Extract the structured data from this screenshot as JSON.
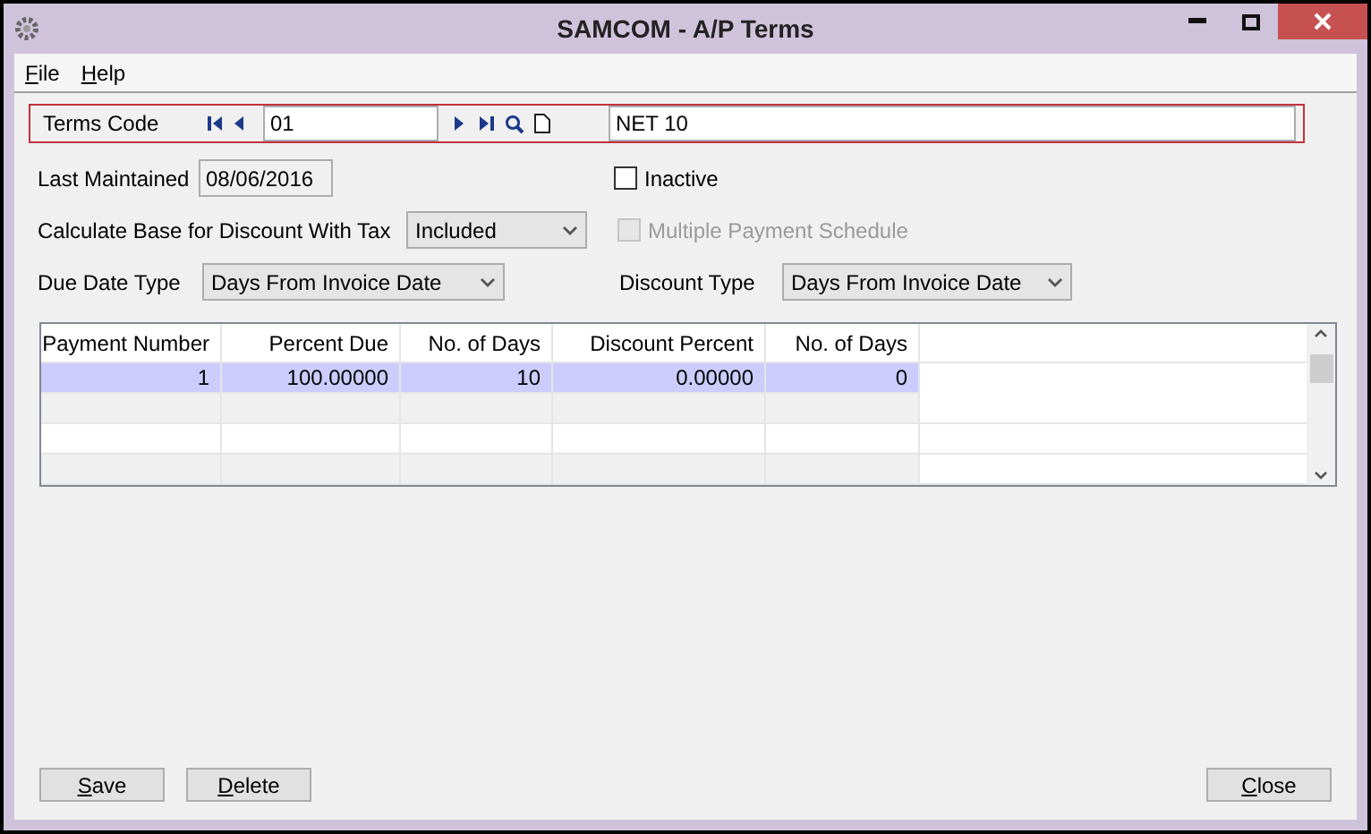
{
  "window": {
    "title": "SAMCOM - A/P Terms"
  },
  "menu": [
    "File",
    "Help"
  ],
  "terms_code": {
    "label": "Terms Code",
    "code": "01",
    "description": "NET 10"
  },
  "last_maintained": {
    "label": "Last Maintained",
    "value": "08/06/2016"
  },
  "inactive": {
    "label": "Inactive",
    "checked": false,
    "disabled": false
  },
  "calc_base": {
    "label": "Calculate Base for Discount With Tax",
    "value": "Included"
  },
  "multiple_payment": {
    "label": "Multiple Payment Schedule",
    "checked": false,
    "disabled": true
  },
  "due_date_type": {
    "label": "Due Date Type",
    "value": "Days From Invoice Date"
  },
  "discount_type": {
    "label": "Discount Type",
    "value": "Days From Invoice Date"
  },
  "table": {
    "columns": [
      "Payment Number",
      "Percent Due",
      "No. of Days",
      "Discount Percent",
      "No. of Days"
    ],
    "rows": [
      {
        "cells": [
          "1",
          "100.00000",
          "10",
          "0.00000",
          "0"
        ],
        "selected": true
      }
    ]
  },
  "buttons": {
    "left": [
      "Save",
      "Delete"
    ],
    "right": [
      "Close"
    ]
  }
}
